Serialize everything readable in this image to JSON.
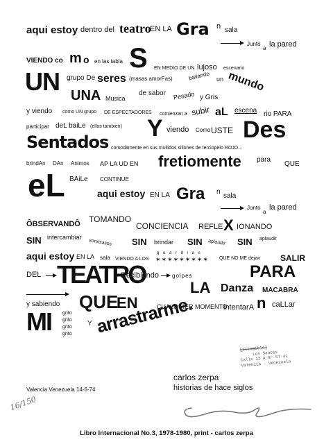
{
  "poem": {
    "l1_a": "aqui estoy",
    "l1_b": "dentro del",
    "l1_c": "teatro",
    "l1_d": "EN LA",
    "l1_e": "Gra",
    "l1_f": "n",
    "l1_g": "sala",
    "l2_a": "Junto",
    "l2_b": "a",
    "l2_c": "la pared",
    "l3_a": "VIENDO co",
    "l3_b": "m",
    "l3_c": "o",
    "l3_d": "en las tabla",
    "l3_e": "S",
    "l3_f": "EN MEDIO DE UN",
    "l3_g": "lujoso",
    "l3_h": "escenario",
    "l4_a": "UN",
    "l4_b": "grupo De",
    "l4_c": "seres",
    "l4_d": "(masas amorFas)",
    "l4_e": "bailando",
    "l4_f": "un",
    "l4_g": "mundo",
    "l5_a": "UNA",
    "l5_b": "Musica",
    "l5_c": "de sabor",
    "l5_d": "Pesado",
    "l5_e": "y Gris",
    "l6_a": "y viendo",
    "l6_b": "como UN grupo",
    "l6_c": "DE ESPECTADORES",
    "l6_d": "comienzan a",
    "l6_e": "subir",
    "l6_f": "aL",
    "l6_g": "escena",
    "l6_h": "rio PARA",
    "l7_a": "participar",
    "l7_b": "deL baiLe",
    "l7_c": "(ellos tambien)",
    "l7_d": "Y",
    "l7_e": "viendo",
    "l7_f": "Como",
    "l7_g": "USTE",
    "l7_h": "Des",
    "l8_a": "Sentados",
    "l8_b": "comodamente en sus mullidos sillones de terciopelo ROJO...",
    "l9_a": "brindAn",
    "l9_b": "DAn",
    "l9_c": "Animos",
    "l9_d": "AP LA UD EN",
    "l9_e": "fretiomente",
    "l9_f": "para",
    "l9_g": "QUE",
    "l10_a": "eL",
    "l10_b": "BAiLe",
    "l10_c": "CONTINUE",
    "l11_a": "aqui estoy",
    "l11_b": "EN LA",
    "l11_c": "Gra",
    "l11_d": "n",
    "l11_e": "sala",
    "l12_a": "Junto",
    "l12_b": "a",
    "l12_c": "la pared",
    "l13_a": "ÔBSERVANDÔ",
    "l13_b": "TOMANDO",
    "l13_c": "CONCIENCIA",
    "l13_d": "REFLE",
    "l13_e": "X",
    "l13_f": "IONANDO",
    "l14_a": "SIN",
    "l14_b": "intercambiar",
    "l14_c": "sonrisasss",
    "l14_d": "SIN",
    "l14_e": "brindar",
    "l14_f": "SIN",
    "l14_g": "aplaudir",
    "l14_h": "SIN",
    "l14_i": "aplaudir",
    "l15_a": "aqui estoy",
    "l15_b": "EN LA",
    "l15_c": "sala",
    "l15_d": "VIENDO A LOS",
    "l15_e": "g u a r d i a s",
    "l15_f": "QUE NO ME dejan",
    "l15_g": "SALIR",
    "l16_a": "DEL",
    "l16_b": "TEATRO",
    "l16_c": "Recibiendo",
    "l16_d": "golpes",
    "l16_e": "PARA",
    "l16_f": "LA",
    "l16_g": "Danza",
    "l16_h": "MACABRA",
    "l17_a": "y sabiendo",
    "l17_b": "QUE",
    "l17_c": "EN",
    "l17_d": "CUALQUIER MOMENTO",
    "l17_e": "intentarA",
    "l17_f": "n",
    "l17_g": "caLLar",
    "l18_a": "MI",
    "l18_b": "grito",
    "l18_c": "grito",
    "l18_d": "grito",
    "l18_e": "grito",
    "l18_f": "Y",
    "l18_g": "arrastrarme."
  },
  "stamp": {
    "line1": "[illegible]",
    "line2": "Los Sauces",
    "line3": "Calle 12 A N° 57-41",
    "line4": "Valencia - Venezuela"
  },
  "signature": {
    "author": "carlos zerpa",
    "work_title": "historias de hace siglos",
    "place_date": "Valencia Venezuela 14-6-74",
    "edition": "16/150"
  },
  "caption": "Libro Internacional No.3, 1978-1980, print - carlos zerpa"
}
